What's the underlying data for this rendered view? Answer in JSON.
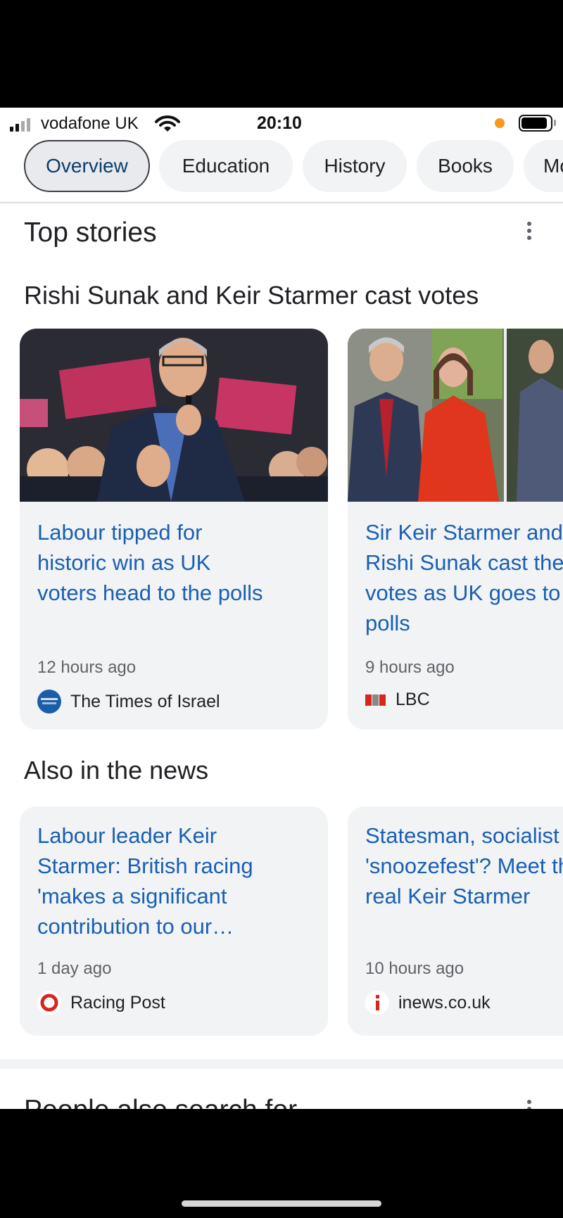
{
  "status_bar": {
    "carrier": "vodafone UK",
    "time": "20:10"
  },
  "tabs": [
    {
      "label": "Overview"
    },
    {
      "label": "Education"
    },
    {
      "label": "History"
    },
    {
      "label": "Books"
    },
    {
      "label": "Mo"
    }
  ],
  "top_stories": {
    "title": "Top stories",
    "cluster_title": "Rishi Sunak and Keir Starmer cast votes",
    "cards": [
      {
        "headline_lines": [
          "Labour tipped for",
          "historic win as UK",
          "voters head to the polls"
        ],
        "time": "12 hours ago",
        "source": "The Times of Israel"
      },
      {
        "headline_lines": [
          "Sir Keir Starmer and",
          "Rishi Sunak cast their",
          "votes as UK goes to the",
          "polls"
        ],
        "time": "9 hours ago",
        "source": "LBC"
      }
    ]
  },
  "also_in_news": {
    "title": "Also in the news",
    "cards": [
      {
        "headline_lines": [
          "Labour leader Keir",
          "Starmer: British racing",
          "'makes a significant",
          "contribution to our…"
        ],
        "time": "1 day ago",
        "source": "Racing Post"
      },
      {
        "headline_lines": [
          "Statesman, socialist or",
          "'snoozefest'? Meet the",
          "real Keir Starmer"
        ],
        "time": "10 hours ago",
        "source": "inews.co.uk"
      }
    ]
  },
  "people_also_search": {
    "title": "People also search for"
  },
  "colors": {
    "link": "#1a5fb4",
    "card_bg": "#f1f3f4",
    "status_dot": "#f59a1b"
  }
}
